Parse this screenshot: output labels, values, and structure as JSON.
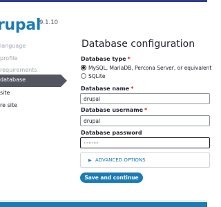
{
  "sidebar": {
    "brand": "rupal",
    "version": "9.1.10",
    "steps": [
      {
        "label": "language"
      },
      {
        "label": "profile"
      },
      {
        "label": "requirements"
      },
      {
        "label": "database"
      },
      {
        "label": "site"
      },
      {
        "label": "re site"
      }
    ]
  },
  "main": {
    "title": "Database configuration",
    "database_type": {
      "label": "Database type",
      "required_mark": "*",
      "options": [
        {
          "label": "MySQL, MariaDB, Percona Server, or equivalent",
          "checked": true
        },
        {
          "label": "SQLite",
          "checked": false
        }
      ]
    },
    "database_name": {
      "label": "Database name",
      "required_mark": "*",
      "value": "drupal"
    },
    "database_username": {
      "label": "Database username",
      "required_mark": "*",
      "value": "drupal"
    },
    "database_password": {
      "label": "Database password",
      "value": "·········"
    },
    "advanced_options": {
      "label": "ADVANCED OPTIONS",
      "icon": "triangle-right-icon"
    },
    "submit_label": "Save and continue"
  },
  "colors": {
    "accent": "#1b7bb5",
    "active_step": "#545560",
    "required": "#d72222",
    "top_bar": "#2f3e90"
  }
}
